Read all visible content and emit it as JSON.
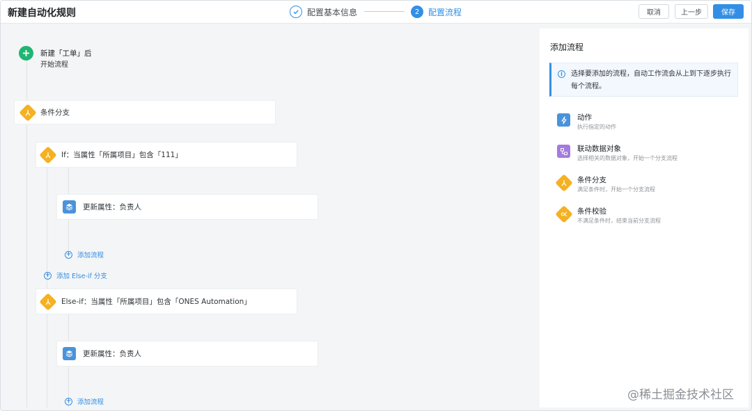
{
  "header": {
    "title": "新建自动化规则",
    "steps": [
      {
        "number": "1",
        "label": "配置基本信息",
        "status": "done"
      },
      {
        "number": "2",
        "label": "配置流程",
        "status": "active"
      }
    ],
    "buttons": {
      "cancel": "取消",
      "prev": "上一步",
      "save": "保存"
    }
  },
  "canvas": {
    "trigger": {
      "title": "新建「工单」后",
      "subtitle": "开始流程"
    },
    "branch_block": {
      "label": "条件分支"
    },
    "if_condition": {
      "label": "If：当属性「所属项目」包含「111」"
    },
    "if_action": {
      "label": "更新属性：负责人"
    },
    "if_add_flow": "添加流程",
    "add_else_if": "添加 Else-if 分支",
    "else_if_condition": {
      "label": "Else-if：当属性「所属项目」包含「ONES Automation」"
    },
    "else_if_action": {
      "label": "更新属性：负责人"
    },
    "else_if_add_flow": "添加流程"
  },
  "panel": {
    "title": "添加流程",
    "info": "选择要添加的流程，自动工作流会从上到下逐步执行每个流程。",
    "items": [
      {
        "title": "动作",
        "desc": "执行指定的动作",
        "icon": "lightning-icon",
        "color": "#4a93db"
      },
      {
        "title": "联动数据对象",
        "desc": "选择相关的数据对象，开始一个分支流程",
        "icon": "linked-data-icon",
        "color": "#a57be0"
      },
      {
        "title": "条件分支",
        "desc": "满足条件时，开始一个分支流程",
        "icon": "branch-icon",
        "color": "#f5b121"
      },
      {
        "title": "条件校验",
        "desc": "不满足条件时，结束当前分支流程",
        "icon": "check-icon",
        "color": "#f5b121"
      }
    ]
  },
  "watermark": "@稀土掘金技术社区",
  "colors": {
    "accent": "#338fe5",
    "trigger": "#20b573",
    "condition": "#f5b121",
    "action": "#4a93db"
  }
}
